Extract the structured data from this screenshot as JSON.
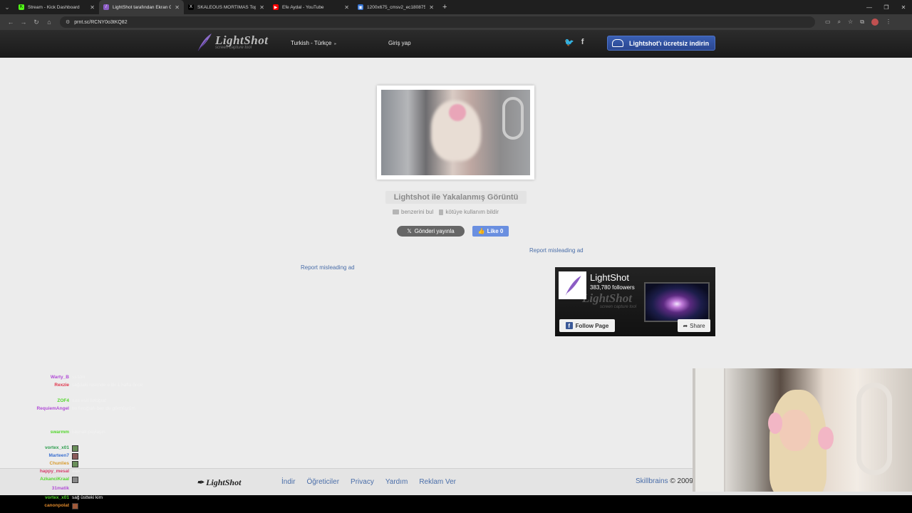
{
  "browser": {
    "tabs": [
      {
        "title": "Stream - Kick Dashboard",
        "color": "#53fc18",
        "glyph": "K"
      },
      {
        "title": "LightShot tarafından Ekran Gö...",
        "color": "#8b5cc4",
        "glyph": "/"
      },
      {
        "title": "SKALEOUS MORTIMAS Topluluk...",
        "color": "#000000",
        "glyph": "X"
      },
      {
        "title": "Efe Aydal - YouTube",
        "color": "#ff0000",
        "glyph": "▶"
      },
      {
        "title": "1200x675_cmsv2_ec180875-7c...",
        "color": "#2f6fd1",
        "glyph": "▣"
      }
    ],
    "url": "prnt.sc/RCNY0o3tKQ82"
  },
  "header": {
    "logo_name": "LightShot",
    "logo_sub": "screen capture tool",
    "language": "Turkish - Türkçe",
    "login": "Giriş yap",
    "twitter": "t",
    "facebook": "f",
    "download": "Lightshot'ı ücretsiz indirin"
  },
  "main": {
    "title": "Lightshot ile Yakalanmış Görüntü",
    "find_similar": "benzerini bul",
    "report_abuse": "kötüye kullanım bildir",
    "tweet": "Gönderi yayınla",
    "like": "Like 0",
    "report_ad_1": "Report misleading ad",
    "report_ad_2": "Report misleading ad"
  },
  "fb_widget": {
    "name": "LightShot",
    "followers": "383,780 followers",
    "watermark": "LightShot",
    "watermark_sub": "screen capture tool",
    "follow": "Follow Page",
    "share": "Share"
  },
  "footer": {
    "logo": "LightShot",
    "links": [
      "İndir",
      "Öğreticiler",
      "Privacy",
      "Yardım",
      "Reklam Ver"
    ],
    "brand": "Skillbrains",
    "copy": "© 2009"
  },
  "chat": {
    "lines": [
      {
        "user": "Warty_B",
        "color": "#b14cd6",
        "msg": "ss kim"
      },
      {
        "user": "Rexzie",
        "color": "#e0334a",
        "msg": "sağdaki resimde o bir 1 hafta önce"
      },
      {
        "user": "ZOF4",
        "color": "#53d62c",
        "msg": "aaa eski fotoğraf"
      },
      {
        "user": "RequiemAngel",
        "color": "#b14cd6",
        "msg": "bu fotoğrafı ben de görmüştüm"
      },
      {
        "user": "swarmm",
        "color": "#53d62c",
        "msg": "kaynak paylaşın"
      },
      {
        "user": "vortex_x01",
        "color": "#2e9e4e",
        "msg": ""
      },
      {
        "user": "Marteen7",
        "color": "#3a6fd0",
        "msg": ""
      },
      {
        "user": "Chunlies",
        "color": "#d69a2c",
        "msg": ""
      },
      {
        "user": "happy_mesal",
        "color": "#d63f6b",
        "msg": "aaa"
      },
      {
        "user": "AzkanciKraal",
        "color": "#53d62c",
        "msg": ""
      },
      {
        "user": "31matik",
        "color": "#b14cd6",
        "msg": ""
      }
    ],
    "bottom_lines": [
      {
        "user": "vortex_x01",
        "color": "#53d62c",
        "msg": "sağ üstteki kim"
      },
      {
        "user": "canonpolat",
        "color": "#e08a2c",
        "msg": ""
      }
    ]
  }
}
